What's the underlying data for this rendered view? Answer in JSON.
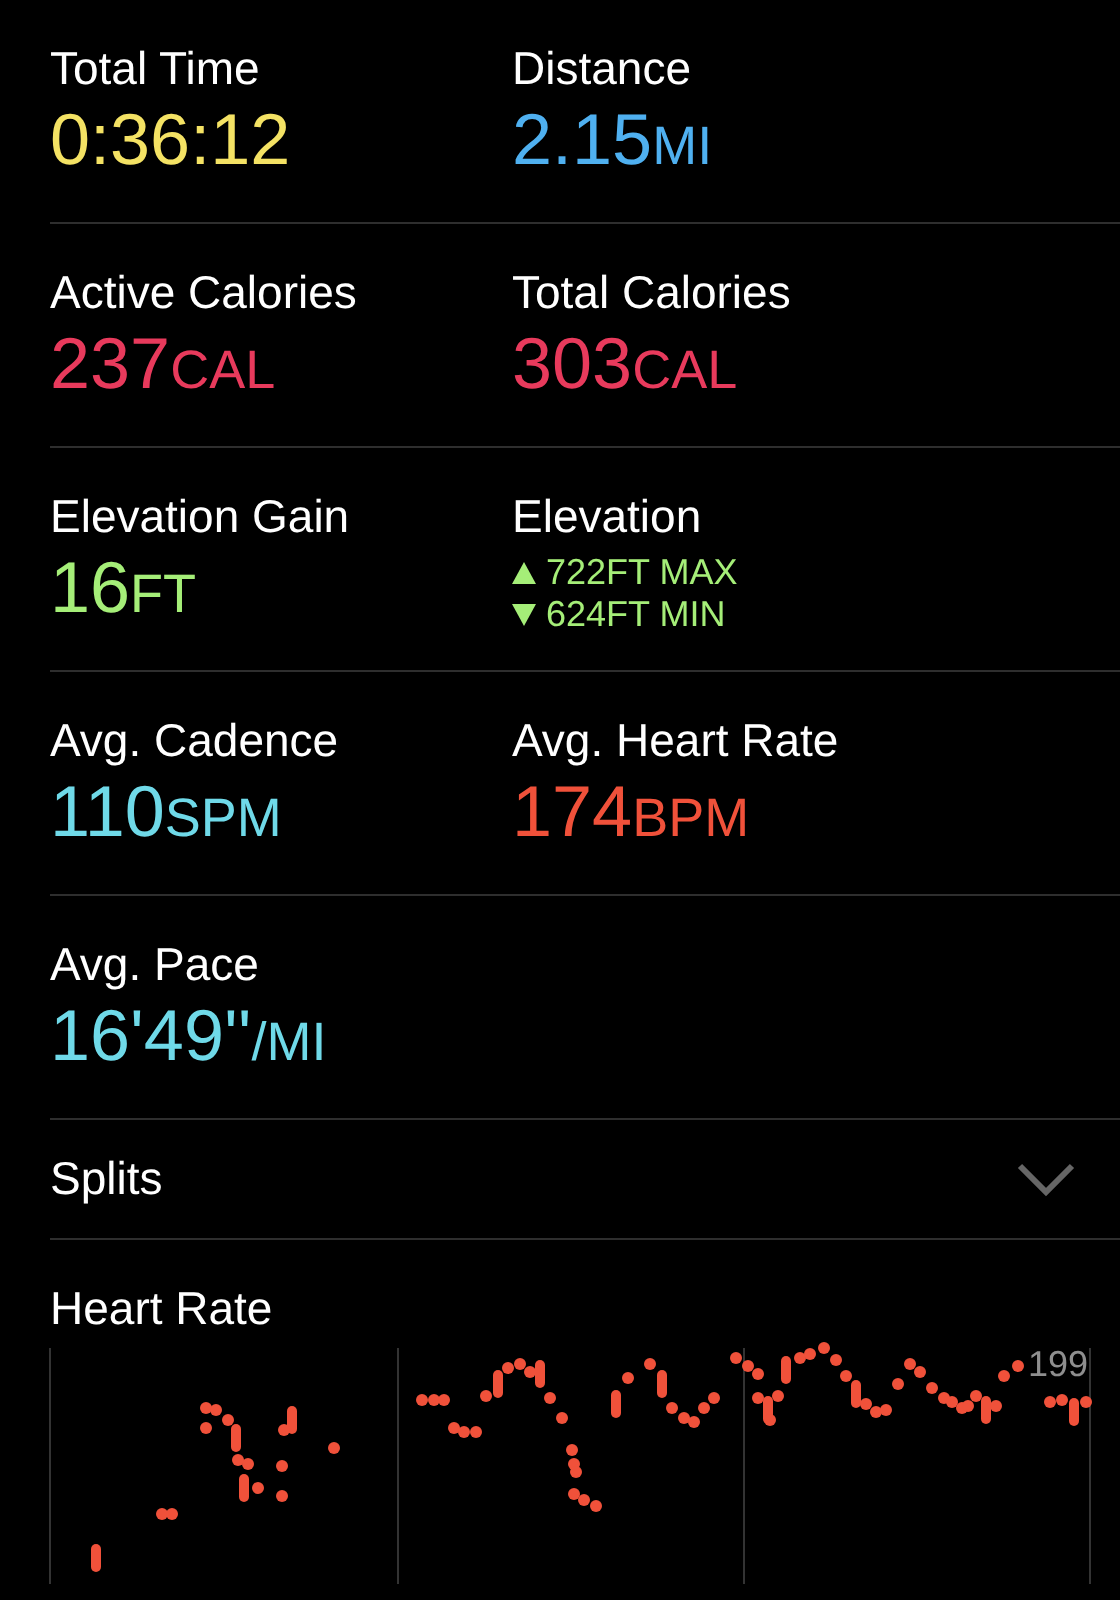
{
  "metric_rows": [
    {
      "cells": [
        {
          "kind": "value",
          "label": "Total Time",
          "value": "0:36:12",
          "color": "#f4e264"
        },
        {
          "kind": "value",
          "label": "Distance",
          "value": "2.15",
          "unit": "MI",
          "color": "#4fb0f0"
        }
      ]
    },
    {
      "cells": [
        {
          "kind": "value",
          "label": "Active Calories",
          "value": "237",
          "unit": "CAL",
          "color": "#e83a5c"
        },
        {
          "kind": "value",
          "label": "Total Calories",
          "value": "303",
          "unit": "CAL",
          "color": "#e83a5c"
        }
      ]
    },
    {
      "cells": [
        {
          "kind": "value",
          "label": "Elevation Gain",
          "value": "16",
          "unit": "FT",
          "color": "#a5ee78"
        },
        {
          "kind": "range",
          "label": "Elevation",
          "max": "722FT MAX",
          "min": "624FT MIN",
          "color": "#a5ee78"
        }
      ]
    },
    {
      "cells": [
        {
          "kind": "value",
          "label": "Avg. Cadence",
          "value": "110",
          "unit": "SPM",
          "color": "#6fd9e8"
        },
        {
          "kind": "value",
          "label": "Avg. Heart Rate",
          "value": "174",
          "unit": "BPM",
          "color": "#f0513a"
        }
      ]
    },
    {
      "cells": [
        {
          "kind": "value",
          "label": "Avg. Pace",
          "value": "16'49''",
          "unit": "/MI",
          "color": "#6fd9e8"
        }
      ]
    }
  ],
  "splits": {
    "label": "Splits",
    "expanded": false
  },
  "heart_rate": {
    "title": "Heart Rate",
    "axis_label": "199"
  }
}
